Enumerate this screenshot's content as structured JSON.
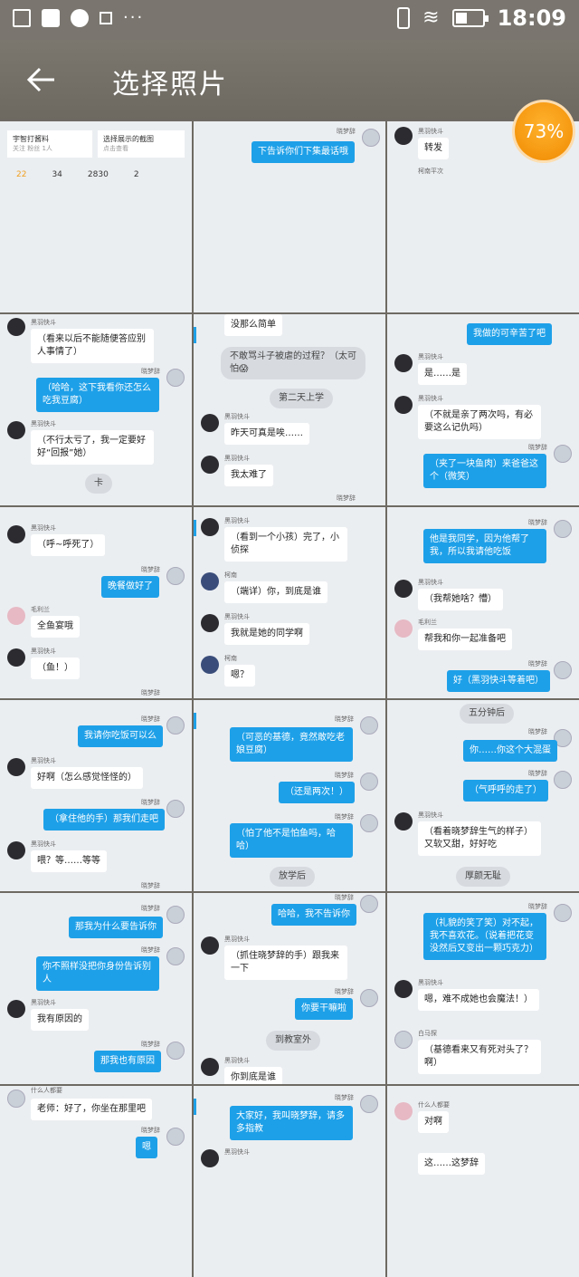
{
  "status": {
    "time": "18:09",
    "more": "···"
  },
  "header": {
    "title": "选择照片"
  },
  "badge": {
    "text": "73%"
  },
  "cells": [
    {
      "profile1": "宇智打酱料",
      "profile1b": "关注 粉丝 1人",
      "profile2": "选择展示的截图",
      "profile2b": "点击查看",
      "nums": [
        "22",
        "34",
        "2830",
        "2"
      ]
    },
    {
      "name1": "晓梦辞",
      "m1": "下告诉你们下集最话哦"
    },
    {
      "name1": "黑羽快斗",
      "m1": "转发",
      "foot": "柯南平次"
    },
    {
      "name1": "黑羽快斗",
      "m1": "（看来以后不能随便答应别人事情了）",
      "name2": "晓梦辞",
      "m2": "（哈哈，这下我看你还怎么吃我豆腐）",
      "name3": "黑羽快斗",
      "m3": "（不行太亏了，我一定要好好“回报”她）",
      "m4": "卡"
    },
    {
      "m1": "没那么简单",
      "m2": "不敢骂斗子被虐的过程？（太可怕😱",
      "m3": "第二天上学",
      "name3": "黑羽快斗",
      "m4": "昨天可真是唉……",
      "name4": "黑羽快斗",
      "m5": "我太难了",
      "name5": "晓梦辞"
    },
    {
      "m1": "我做的可辛苦了吧",
      "name1": "黑羽快斗",
      "m2": "是……是",
      "name2": "黑羽快斗",
      "m3": "（不就是亲了两次吗，有必要这么记仇吗）",
      "name3": "晓梦辞",
      "m4": "（夹了一块鱼肉）来爸爸这个（微笑）"
    },
    {
      "name1": "黑羽快斗",
      "m1": "（呼~呼死了）",
      "name2": "晓梦辞",
      "m2": "晚餐做好了",
      "name3": "毛利兰",
      "m3": "全鱼宴哦",
      "name4": "黑羽快斗",
      "m4": "（鱼！）",
      "name5": "晓梦辞"
    },
    {
      "name1": "黑羽快斗",
      "m1": "（看到一个小孩）完了，小侦探",
      "name2": "柯南",
      "m2": "（端详）你，到底是谁",
      "name3": "黑羽快斗",
      "m3": "我就是她的同学啊",
      "name4": "柯南",
      "m4": "嗯？"
    },
    {
      "name1": "晓梦辞",
      "m1": "他是我同学，因为他帮了我，所以我请他吃饭",
      "name2": "黑羽快斗",
      "m2": "（我帮她啥？懵）",
      "name3": "毛利兰",
      "m3": "帮我和你一起准备吧",
      "name4": "晓梦辞",
      "m4": "好（黑羽快斗等着吧）"
    },
    {
      "name1": "晓梦辞",
      "m1": "我请你吃饭可以么",
      "name2": "黑羽快斗",
      "m2": "好啊（怎么感觉怪怪的）",
      "name3": "晓梦辞",
      "m3": "（拿住他的手）那我们走吧",
      "name4": "黑羽快斗",
      "m4": "喂？等……等等",
      "name5": "晓梦辞"
    },
    {
      "name1": "晓梦辞",
      "m1": "（可恶的基德，竟然敢吃老娘豆腐）",
      "name2": "晓梦辞",
      "m2": "（还是两次！）",
      "name3": "晓梦辞",
      "m3": "（怕了他不是怕鱼吗，哈哈）",
      "m4": "放学后"
    },
    {
      "m1": "五分钟后",
      "name1": "晓梦辞",
      "m2": "你……你这个大混蛋",
      "name2": "晓梦辞",
      "m3": "（气呼呼的走了）",
      "name3": "黑羽快斗",
      "m4": "（看着晓梦辞生气的样子）又软又甜，好好吃",
      "m5": "厚颜无耻"
    },
    {
      "name1": "晓梦辞",
      "m1": "那我为什么要告诉你",
      "name2": "晓梦辞",
      "m2": "你不照样没把你身份告诉别人",
      "name3": "黑羽快斗",
      "m3": "我有原因的",
      "name4": "晓梦辞",
      "m4": "那我也有原因"
    },
    {
      "name1": "晓梦辞",
      "m1": "哈哈，我不告诉你",
      "name2": "黑羽快斗",
      "m2": "（抓住晓梦辞的手）跟我来一下",
      "name3": "晓梦辞",
      "m3": "你要干嘛啦",
      "m4": "到教室外",
      "name4": "黑羽快斗",
      "m5": "你到底是谁"
    },
    {
      "name1": "晓梦辞",
      "m1": "（礼貌的笑了笑）对不起，我不喜欢花。（说着把花变没然后又变出一颗巧克力）",
      "name2": "黑羽快斗",
      "m2": "嗯，难不成她也会魔法！）",
      "name3": "白马探",
      "m3": "（基德看来又有死对头了？啊）"
    },
    {
      "name1": "什么人都要",
      "m1": "老师：好了，你坐在那里吧",
      "name2": "晓梦辞",
      "m2": "嗯"
    },
    {
      "name1": "晓梦辞",
      "m1": "大家好，我叫晓梦辞，请多多指教",
      "name2": "黑羽快斗"
    },
    {
      "name1": "什么人都要",
      "m1": "对啊",
      "m2": "这……这梦辞"
    }
  ]
}
